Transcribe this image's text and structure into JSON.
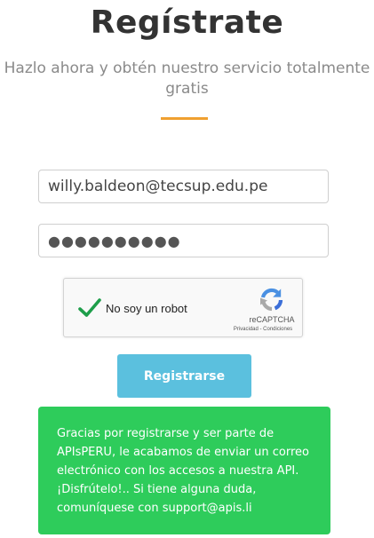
{
  "header": {
    "title": "Regístrate",
    "subtitle": "Hazlo ahora y obtén nuestro servicio totalmente gratis"
  },
  "form": {
    "email_value": "willy.baldeon@tecsup.edu.pe",
    "password_value": "●●●●●●●●●●"
  },
  "captcha": {
    "label": "No soy un robot",
    "brand": "reCAPTCHA",
    "links": "Privacidad - Condiciones",
    "checked": true,
    "check_icon": "check-icon",
    "logo_icon": "recaptcha-logo-icon"
  },
  "submit": {
    "label": "Registrarse"
  },
  "alert": {
    "message": "Gracias por registrarse y ser parte de APIsPERU, le acabamos de enviar un correo electrónico con los accesos a nuestra API. ¡Disfrútelo!.. Si tiene alguna duda, comuníquese con support@apis.li"
  },
  "colors": {
    "accent_line": "#f0a030",
    "button": "#5bc0de",
    "alert_background": "#2ecc5b",
    "check": "#1e9e4a"
  }
}
